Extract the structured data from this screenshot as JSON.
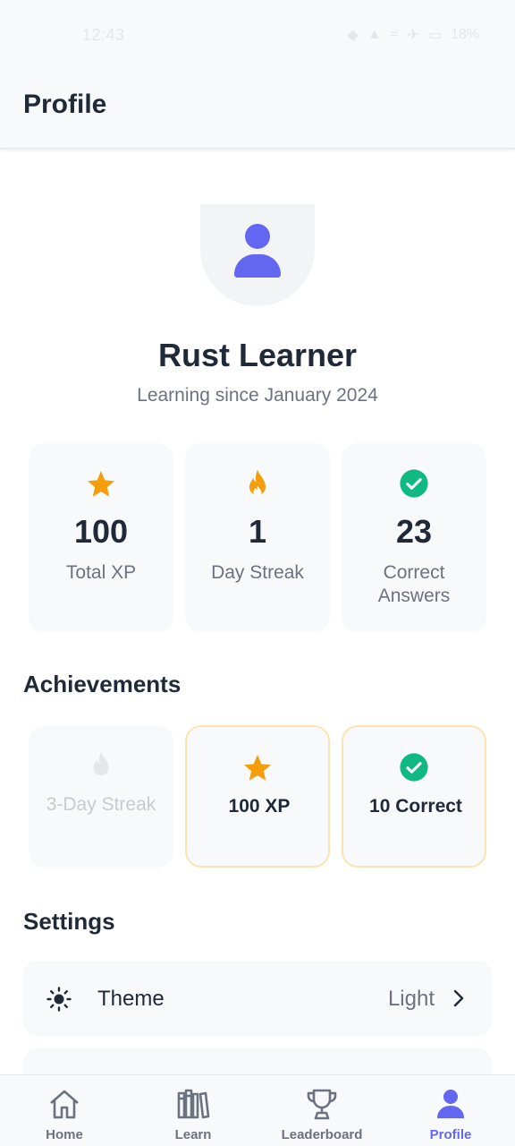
{
  "status_bar": {
    "time": "12:43",
    "battery": "18%"
  },
  "header": {
    "title": "Profile"
  },
  "profile": {
    "name": "Rust Learner",
    "since": "Learning since January 2024"
  },
  "stats": [
    {
      "icon": "star-icon",
      "value": "100",
      "label": "Total XP",
      "color": "#f59e0b"
    },
    {
      "icon": "flame-icon",
      "value": "1",
      "label": "Day Streak",
      "color": "#f59e0b"
    },
    {
      "icon": "check-circle-icon",
      "value": "23",
      "label": "Correct Answers",
      "color": "#10b981"
    }
  ],
  "achievements": {
    "title": "Achievements",
    "items": [
      {
        "icon": "flame-icon",
        "label": "3-Day Streak",
        "unlocked": false
      },
      {
        "icon": "star-icon",
        "label": "100 XP",
        "unlocked": true
      },
      {
        "icon": "check-circle-icon",
        "label": "10 Correct",
        "unlocked": true
      }
    ]
  },
  "settings": {
    "title": "Settings",
    "items": [
      {
        "icon": "sun-icon",
        "label": "Theme",
        "value": "Light"
      }
    ]
  },
  "nav": [
    {
      "icon": "home-icon",
      "label": "Home",
      "active": false
    },
    {
      "icon": "books-icon",
      "label": "Learn",
      "active": false
    },
    {
      "icon": "trophy-icon",
      "label": "Leaderboard",
      "active": false
    },
    {
      "icon": "user-icon",
      "label": "Profile",
      "active": true
    }
  ],
  "colors": {
    "accent": "#6366f1",
    "gold": "#f59e0b",
    "green": "#10b981",
    "text": "#1f2937",
    "muted": "#6b7280"
  }
}
